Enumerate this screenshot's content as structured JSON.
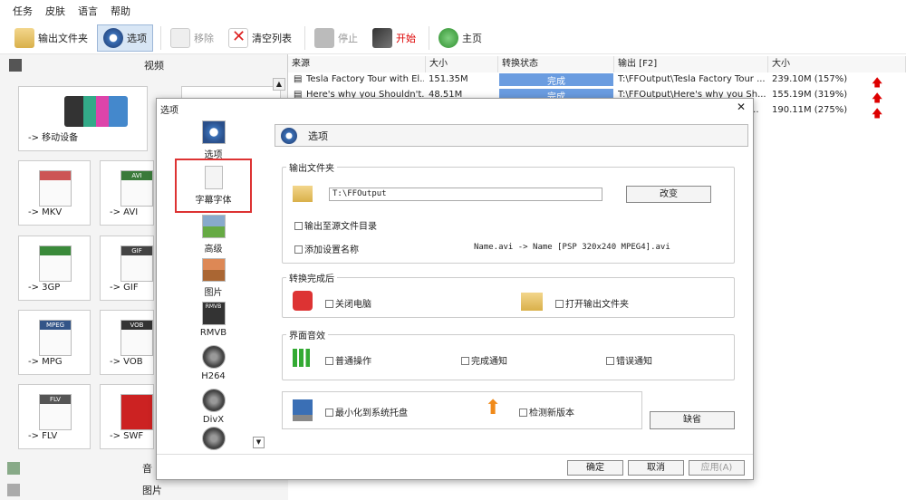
{
  "menu": [
    "任务",
    "皮肤",
    "语言",
    "帮助"
  ],
  "toolbar": {
    "output_folder": "输出文件夹",
    "options": "选项",
    "remove": "移除",
    "clear_list": "清空列表",
    "stop": "停止",
    "start": "开始",
    "home": "主页"
  },
  "left": {
    "video_header": "视频",
    "tiles": [
      "-> 移动设备",
      "-> MKV",
      "-> AVI",
      "-> 3GP",
      "-> GIF",
      "-> MPG",
      "-> VOB",
      "-> FLV",
      "-> SWF"
    ],
    "badges": [
      "AVI",
      "GIF",
      "MPEG",
      "VOB",
      "FLV"
    ],
    "audio_header": "音",
    "picture_header": "图片"
  },
  "list": {
    "headers": [
      "来源",
      "大小",
      "转换状态",
      "输出 [F2]",
      "大小"
    ],
    "rows": [
      {
        "source": "Tesla Factory Tour with El...",
        "size": "151.35M",
        "status": "完成",
        "output": "T:\\FFOutput\\Tesla Factory Tour ...",
        "out_size": "239.10M  (157%)"
      },
      {
        "source": "Here's why you Shouldn't...",
        "size": "48.51M",
        "status": "完成",
        "output": "T:\\FFOutput\\Here's why you Sh...",
        "out_size": "155.19M  (319%)"
      },
      {
        "source": "",
        "size": "",
        "status": "",
        "output": "...",
        "out_size": "190.11M  (275%)"
      }
    ]
  },
  "dialog": {
    "title": "选项",
    "close": "✕",
    "side": [
      "选项",
      "字幕字体",
      "高级",
      "图片",
      "RMVB",
      "H264",
      "DivX"
    ],
    "side_badges": [
      "RMVB"
    ],
    "header": "选项",
    "output_group": "输出文件夹",
    "path": "T:\\FFOutput",
    "change_btn": "改变",
    "to_source_dir": "输出至源文件目录",
    "add_setting_name": "添加设置名称",
    "name_example": "Name.avi  -> Name [PSP 320x240 MPEG4].avi",
    "after_group": "转换完成后",
    "shutdown": "关闭电脑",
    "open_folder": "打开输出文件夹",
    "sound_group": "界面音效",
    "sound_normal": "普通操作",
    "sound_done": "完成通知",
    "sound_error": "错误通知",
    "minimize_tray": "最小化到系统托盘",
    "check_update": "检测新版本",
    "default_btn": "缺省",
    "ok": "确定",
    "cancel": "取消",
    "apply": "应用(A)"
  }
}
